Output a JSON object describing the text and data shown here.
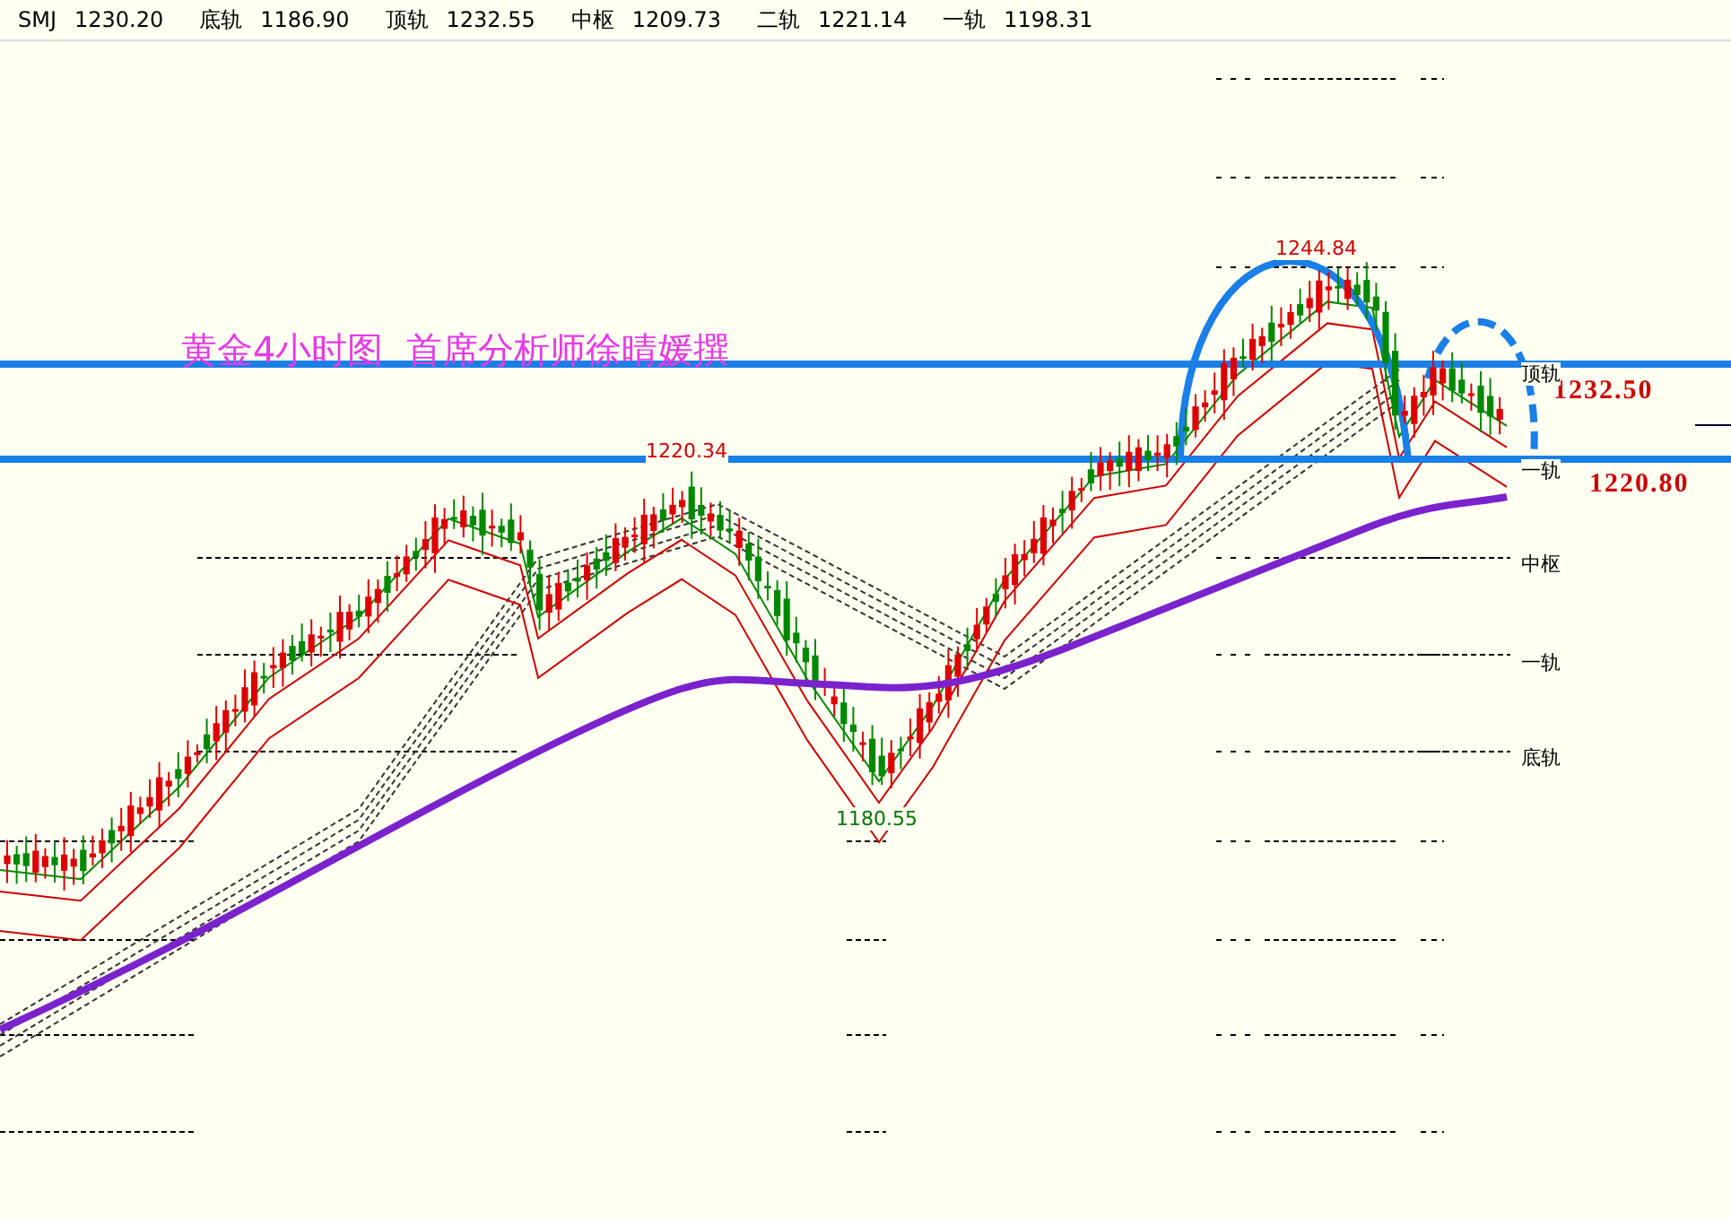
{
  "header": {
    "items": [
      {
        "label": "SMJ",
        "value": "1230.20"
      },
      {
        "label": "底轨",
        "value": "1186.90"
      },
      {
        "label": "顶轨",
        "value": "1232.55"
      },
      {
        "label": "中枢",
        "value": "1209.73"
      },
      {
        "label": "二轨",
        "value": "1221.14"
      },
      {
        "label": "一轨",
        "value": "1198.31"
      }
    ]
  },
  "chart": {
    "title": "黄金4小时图  首席分析师徐晴媛撰",
    "price_labels": [
      "1232.50",
      "1220.80"
    ],
    "extreme_labels": [
      {
        "text": "1244.84",
        "kind": "high"
      },
      {
        "text": "1220.34",
        "kind": "high"
      },
      {
        "text": "1180.55",
        "kind": "low"
      }
    ],
    "level_labels": [
      "顶轨",
      "一轨",
      "中枢",
      "一轨",
      "底轨"
    ]
  }
}
